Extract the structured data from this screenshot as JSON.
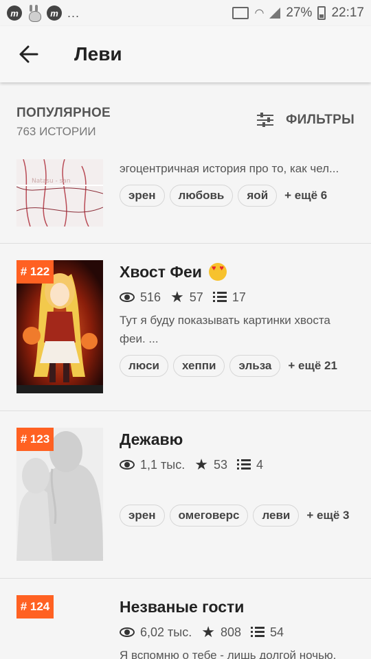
{
  "status_bar": {
    "app_icon_1": "m",
    "app_icon_2": "m",
    "dots": "...",
    "battery": "27%",
    "time": "22:17"
  },
  "app_bar": {
    "back_icon": "arrow-left-icon",
    "title": "Леви"
  },
  "list_header": {
    "title": "ПОПУЛЯРНОЕ",
    "count": "763 ИСТОРИИ",
    "filters_label": "ФИЛЬТРЫ"
  },
  "stories": [
    {
      "desc": "эгоцентричная история про то, как чел...",
      "cover_text": "Natasu - san",
      "tags": [
        "эрен",
        "любовь",
        "яой"
      ],
      "more": "+ ещё 6"
    },
    {
      "rank": "# 122",
      "title": "Хвост Феи",
      "views": "516",
      "stars": "57",
      "parts": "17",
      "desc": "Тут я буду показывать картинки хвоста феи. ...",
      "tags": [
        "люси",
        "хеппи",
        "эльза"
      ],
      "more": "+ ещё 21"
    },
    {
      "rank": "# 123",
      "title": "Дежавю",
      "views": "1,1 тыс.",
      "stars": "53",
      "parts": "4",
      "tags": [
        "эрен",
        "омеговерс",
        "леви"
      ],
      "more": "+ ещё 3"
    },
    {
      "rank": "# 124",
      "title": "Незваные гости",
      "views": "6,02 тыс.",
      "stars": "808",
      "parts": "54",
      "desc": "Я вспомню о тебе - лишь долгой ночью,"
    }
  ],
  "colors": {
    "accent": "#ff6122",
    "background": "#f5f5f5",
    "text": "#222222"
  }
}
